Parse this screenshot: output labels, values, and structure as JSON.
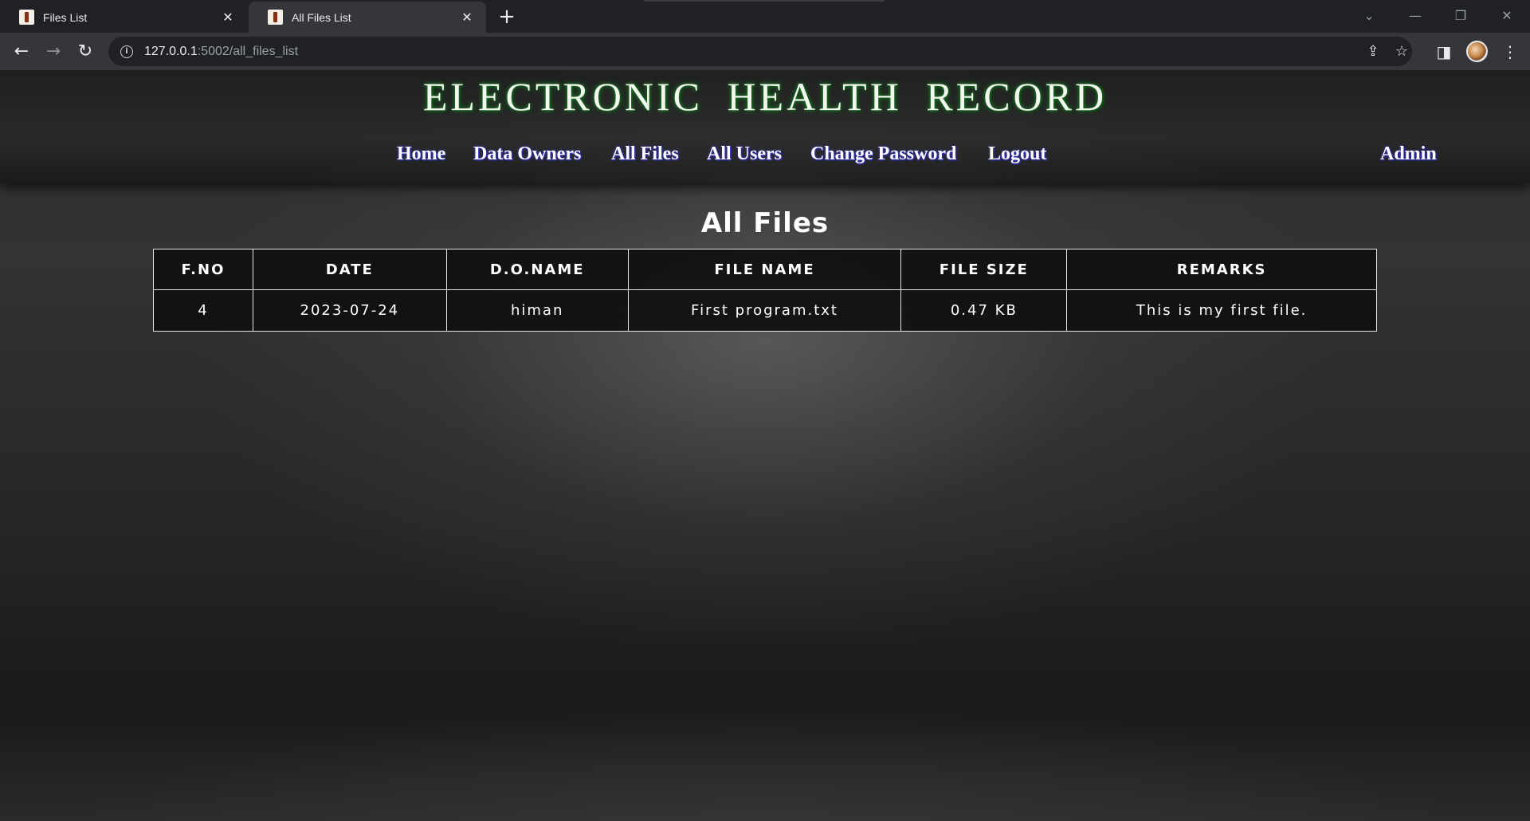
{
  "browser": {
    "tabs": [
      {
        "title": "Files List",
        "active": false
      },
      {
        "title": "All Files List",
        "active": true
      }
    ],
    "new_tab_glyph": "+",
    "url_host": "127.0.0.1",
    "url_path": ":5002/all_files_list",
    "icons": {
      "back": "arrow-left-icon",
      "forward": "arrow-right-icon",
      "reload": "reload-icon",
      "site_info": "info-icon",
      "share": "share-icon",
      "bookmark": "star-icon",
      "side_panel": "side-panel-icon",
      "profile": "avatar",
      "menu": "kebab-menu-icon"
    }
  },
  "site": {
    "title": "ELECTRONIC HEALTH RECORD",
    "title_glow_color": "#1f8f2a",
    "nav": {
      "home": "Home",
      "data_owners": "Data Owners",
      "all_files": "All Files",
      "all_users": "All Users",
      "change_password": "Change Password",
      "logout": "Logout",
      "admin": "Admin"
    }
  },
  "main": {
    "heading": "All Files",
    "table": {
      "headers": [
        "F.NO",
        "DATE",
        "D.O.NAME",
        "FILE NAME",
        "FILE SIZE",
        "REMARKS"
      ],
      "rows": [
        [
          "4",
          "2023-07-24",
          "himan",
          "First program.txt",
          "0.47 KB",
          "This is my first file."
        ]
      ]
    }
  }
}
